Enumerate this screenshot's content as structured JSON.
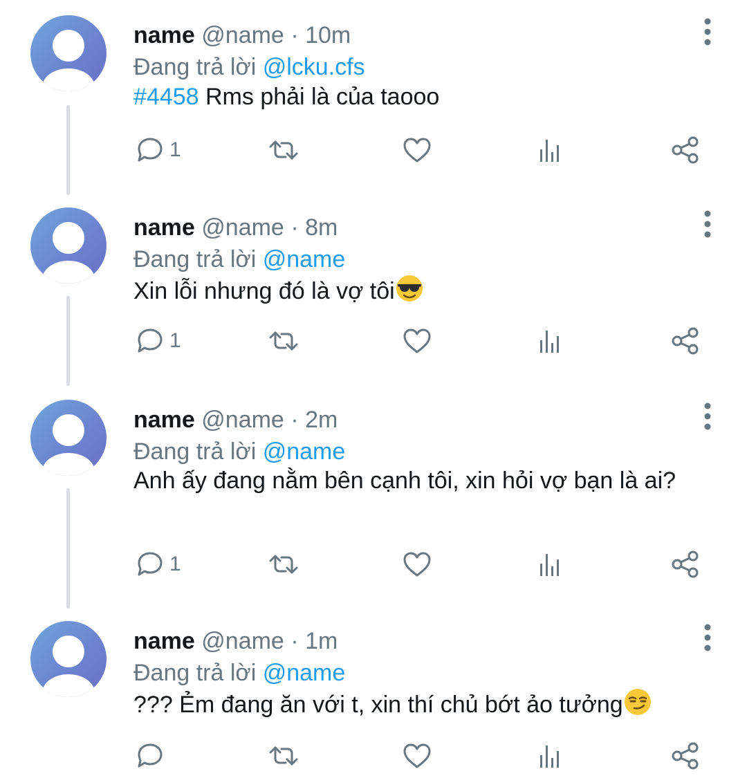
{
  "tweets": [
    {
      "name": "name",
      "handle": "@name",
      "separator": "·",
      "time": "10m",
      "reply_prefix": "Đang trả lời",
      "reply_to": "@lcku.cfs",
      "hashtag": "#4458",
      "text": " Rms phải là của taooo",
      "emoji": "",
      "reply_count": "1"
    },
    {
      "name": "name",
      "handle": "@name",
      "separator": "·",
      "time": "8m",
      "reply_prefix": "Đang trả lời",
      "reply_to": "@name",
      "hashtag": "",
      "text": "Xin lỗi nhưng đó là vợ tôi",
      "emoji": "sunglasses-emoji",
      "reply_count": "1"
    },
    {
      "name": "name",
      "handle": "@name",
      "separator": "·",
      "time": "2m",
      "reply_prefix": "Đang trả lời",
      "reply_to": "@name",
      "hashtag": "",
      "text": "Anh ấy đang nằm bên cạnh tôi, xin hỏi vợ bạn là ai?",
      "emoji": "",
      "reply_count": "1"
    },
    {
      "name": "name",
      "handle": "@name",
      "separator": "·",
      "time": "1m",
      "reply_prefix": "Đang trả lời",
      "reply_to": "@name",
      "hashtag": "",
      "text": "??? Ẻm đang ăn với t, xin thí chủ bớt ảo tưởng",
      "emoji": "smirk-emoji",
      "reply_count": ""
    }
  ],
  "icons": {
    "more": "more-vertical-icon",
    "reply": "reply-icon",
    "retweet": "retweet-icon",
    "like": "heart-icon",
    "stats": "stats-icon",
    "share": "share-icon"
  },
  "colors": {
    "link": "#1d9bf0",
    "muted": "#68767f",
    "text": "#14171a",
    "thread_line": "#d9dde1"
  }
}
